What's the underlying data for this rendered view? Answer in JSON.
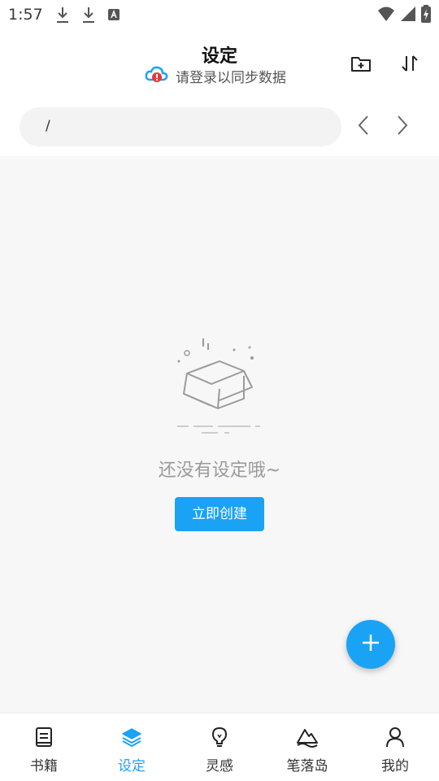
{
  "status_bar": {
    "time": "1:57",
    "left_icons": [
      "download-icon",
      "download-icon",
      "text-icon"
    ],
    "right_icons": [
      "wifi-icon",
      "signal-icon",
      "battery-charging-icon"
    ]
  },
  "header": {
    "title": "设定",
    "subtitle": "请登录以同步数据",
    "cloud_icon": "cloud-alert-icon",
    "actions": [
      "new-folder-icon",
      "sort-icon"
    ]
  },
  "path_bar": {
    "path": "/",
    "back_icon": "chevron-left-icon",
    "forward_icon": "chevron-right-icon"
  },
  "empty_state": {
    "icon": "empty-box-icon",
    "message": "还没有设定哦~",
    "button_label": "立即创建"
  },
  "fab": {
    "icon": "plus-icon"
  },
  "bottom_nav": {
    "items": [
      {
        "label": "书籍",
        "icon": "book-icon",
        "active": false
      },
      {
        "label": "设定",
        "icon": "layers-icon",
        "active": true
      },
      {
        "label": "灵感",
        "icon": "lightbulb-icon",
        "active": false
      },
      {
        "label": "笔落岛",
        "icon": "mountain-icon",
        "active": false
      },
      {
        "label": "我的",
        "icon": "user-icon",
        "active": false
      }
    ]
  },
  "colors": {
    "accent": "#1aa2f5",
    "empty_text": "#9a9a9a",
    "alert": "#e53935"
  }
}
